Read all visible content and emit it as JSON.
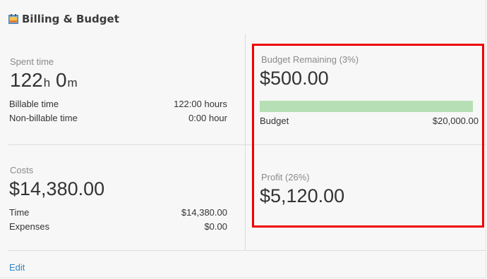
{
  "header": {
    "title": "Billing & Budget",
    "icon": "billing-calendar-icon"
  },
  "spent": {
    "label": "Spent time",
    "hours": "122",
    "hours_unit": "h",
    "minutes": "0",
    "minutes_unit": "m",
    "billable_label": "Billable time",
    "billable_value": "122:00 hours",
    "nonbillable_label": "Non-billable time",
    "nonbillable_value": "0:00 hour"
  },
  "costs": {
    "label": "Costs",
    "total": "$14,380.00",
    "time_label": "Time",
    "time_value": "$14,380.00",
    "expenses_label": "Expenses",
    "expenses_value": "$0.00"
  },
  "budget": {
    "remaining_label": "Budget Remaining (3%)",
    "remaining_value": "$500.00",
    "bar_fill_percent": 100,
    "bar_color": "#b6dfb5",
    "budget_label": "Budget",
    "budget_value": "$20,000.00"
  },
  "profit": {
    "label": "Profit (26%)",
    "value": "$5,120.00"
  },
  "footer": {
    "edit_label": "Edit"
  },
  "colors": {
    "highlight": "#ee0000",
    "link": "#2f86c5"
  }
}
